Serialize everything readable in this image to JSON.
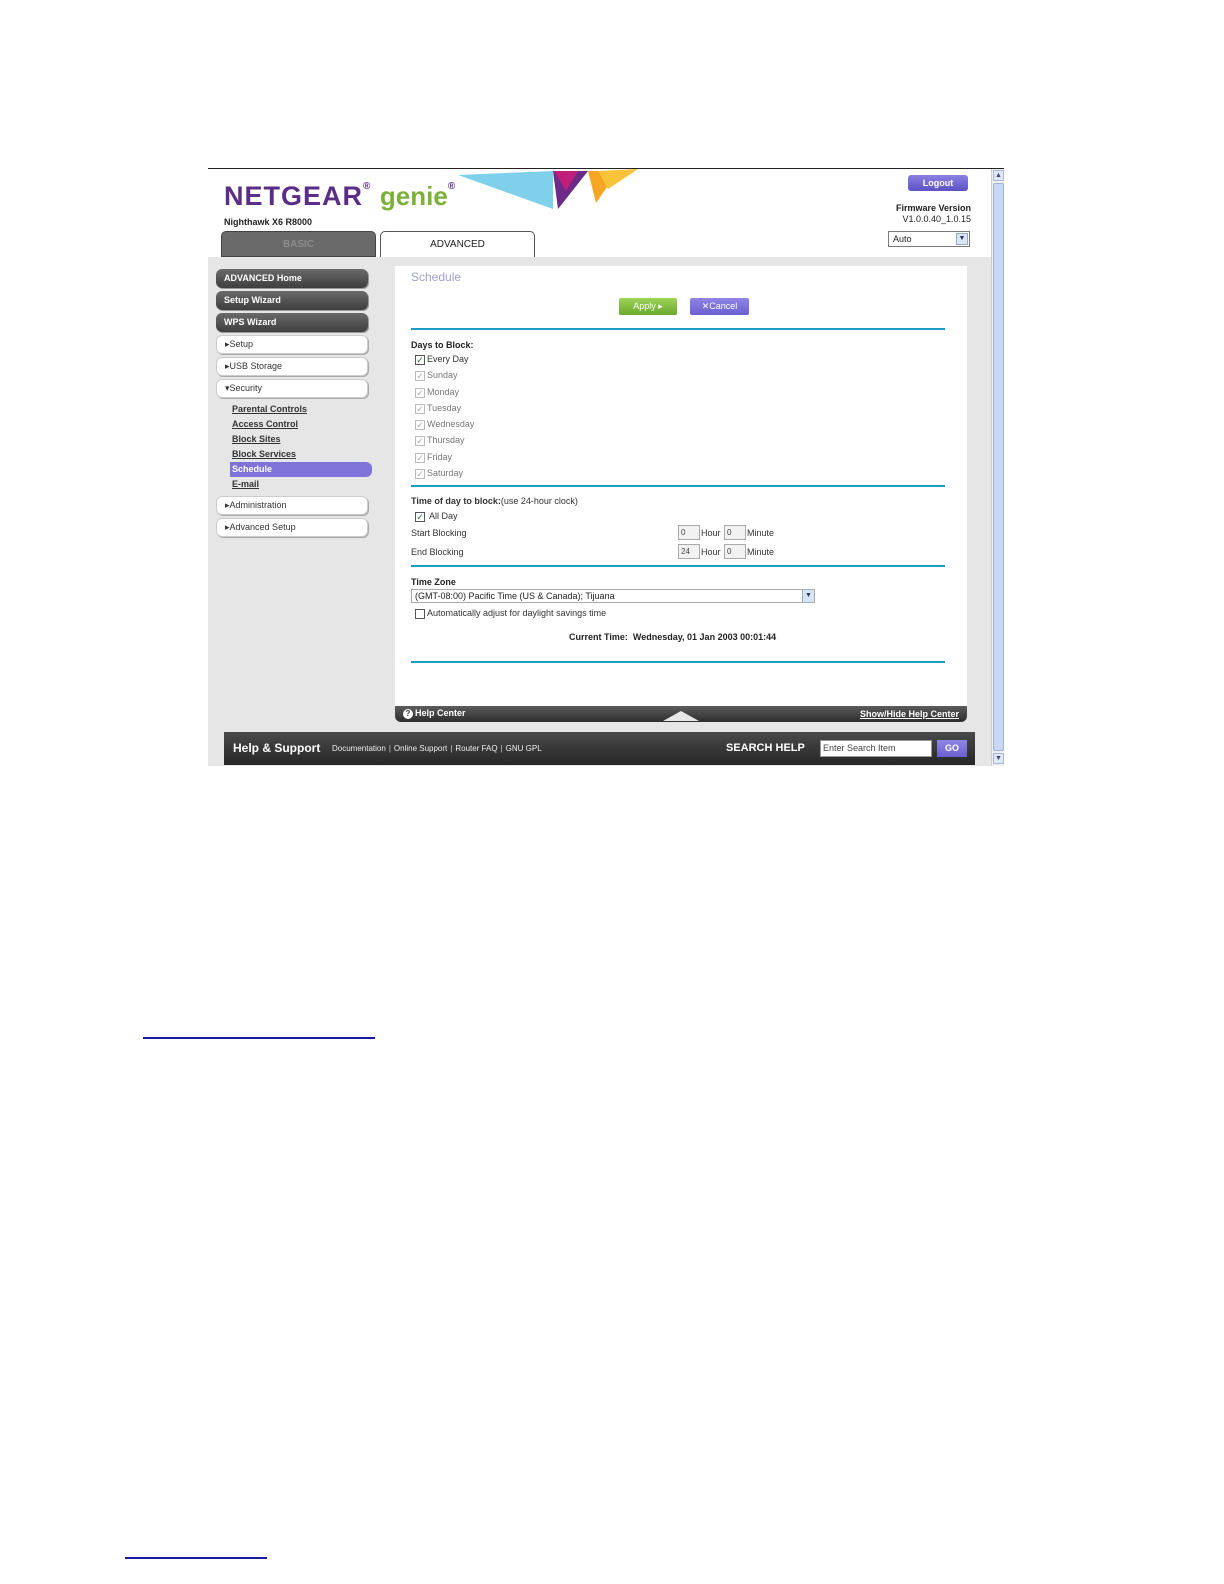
{
  "header": {
    "brand": "NETGEAR",
    "brand_reg": "®",
    "product": "genie",
    "product_reg": "®",
    "model": "Nighthawk X6 R8000",
    "logout_label": "Logout",
    "firmware_label": "Firmware Version",
    "firmware_value": "V1.0.0.40_1.0.15",
    "language_select": "Auto"
  },
  "tabs": {
    "basic": "BASIC",
    "advanced": "ADVANCED"
  },
  "sidebar": {
    "advanced_home": "ADVANCED Home",
    "setup_wizard": "Setup Wizard",
    "wps_wizard": "WPS Wizard",
    "setup": "Setup",
    "usb_storage": "USB Storage",
    "security": "Security",
    "security_items": [
      "Parental Controls",
      "Access Control",
      "Block Sites",
      "Block Services",
      "Schedule",
      "E-mail"
    ],
    "administration": "Administration",
    "advanced_setup": "Advanced Setup"
  },
  "main": {
    "title": "Schedule",
    "apply_label": "Apply",
    "cancel_label": "Cancel",
    "days_label": "Days to Block:",
    "days": [
      {
        "label": "Every Day",
        "checked": true
      },
      {
        "label": "Sunday",
        "checked": true
      },
      {
        "label": "Monday",
        "checked": true
      },
      {
        "label": "Tuesday",
        "checked": true
      },
      {
        "label": "Wednesday",
        "checked": true
      },
      {
        "label": "Thursday",
        "checked": true
      },
      {
        "label": "Friday",
        "checked": true
      },
      {
        "label": "Saturday",
        "checked": true
      }
    ],
    "time_label": "Time of day to block:",
    "time_note": "(use 24-hour clock)",
    "all_day": "All Day",
    "start_label": "Start Blocking",
    "end_label": "End Blocking",
    "start_hour": "0",
    "start_minute": "0",
    "end_hour": "24",
    "end_minute": "0",
    "hour_label": "Hour",
    "minute_label": "Minute",
    "timezone_label": "Time Zone",
    "timezone_value": "(GMT-08:00) Pacific Time (US & Canada); Tijuana",
    "dst_label": "Automatically adjust for daylight savings time",
    "current_time_label": "Current Time:",
    "current_time_value": "Wednesday, 01 Jan 2003 00:01:44"
  },
  "helpbar": {
    "help_center": "Help Center",
    "show_hide": "Show/Hide Help Center"
  },
  "footer": {
    "title": "Help & Support",
    "links": [
      "Documentation",
      "Online Support",
      "Router FAQ",
      "GNU GPL"
    ],
    "search_label": "SEARCH HELP",
    "search_placeholder": "Enter Search Item",
    "go_label": "GO"
  },
  "colors": {
    "brand_purple": "#5b2d86",
    "genie_green": "#7bb13a",
    "accent_blue": "#1d9cc5",
    "button_purple": "#6a5fd0"
  }
}
